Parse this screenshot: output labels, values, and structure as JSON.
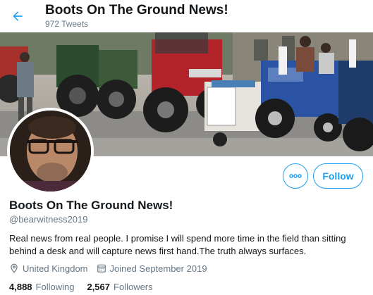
{
  "header": {
    "title": "Boots On The Ground News!",
    "tweet_count": "972 Tweets",
    "back_icon": "arrow-left-icon"
  },
  "banner": {
    "description_icon": "tractor-protest-photo"
  },
  "profile": {
    "display_name": "Boots On The Ground News!",
    "handle": "@bearwitness2019",
    "bio": "Real news from real people. I promise I will spend more time in the field than sitting behind a desk and will capture news first hand.The truth always surfaces.",
    "location": "United Kingdom",
    "joined": "Joined September 2019",
    "following_count": "4,888",
    "following_label": "Following",
    "followers_count": "2,567",
    "followers_label": "Followers"
  },
  "actions": {
    "follow_label": "Follow",
    "more_icon": "more-horizontal-icon"
  },
  "colors": {
    "accent": "#1da1f2",
    "text_primary": "#14171a",
    "text_secondary": "#657786"
  }
}
